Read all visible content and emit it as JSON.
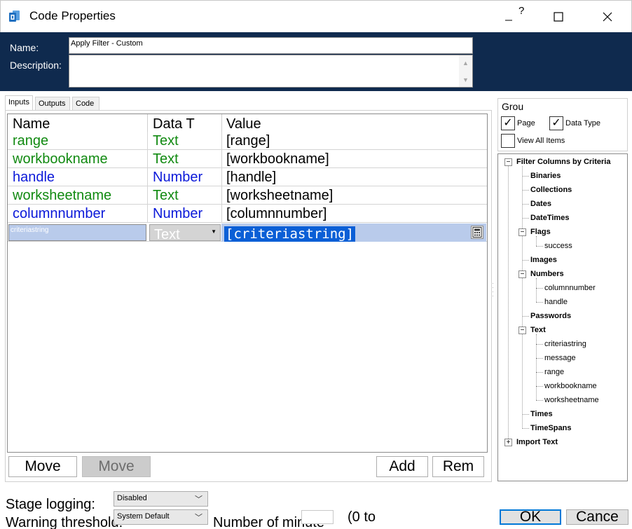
{
  "window": {
    "title": "Code Properties",
    "help": "?",
    "minimize": "—",
    "maximize": "☐",
    "close": "✕"
  },
  "header": {
    "name_label": "Name:",
    "description_label": "Description:",
    "name_value": "Apply Filter - Custom",
    "description_value": ""
  },
  "tabs": [
    {
      "label": "Inputs",
      "active": true
    },
    {
      "label": "Outputs",
      "active": false
    },
    {
      "label": "Code",
      "active": false
    }
  ],
  "grid": {
    "columns": [
      "Name",
      "Data T",
      "Value"
    ],
    "rows": [
      {
        "name": "range",
        "type": "Text",
        "value": "[range]",
        "color": "#118a11"
      },
      {
        "name": "workbookname",
        "type": "Text",
        "value": "[workbookname]",
        "color": "#118a11"
      },
      {
        "name": "handle",
        "type": "Number",
        "value": "[handle]",
        "color": "#0b19d9"
      },
      {
        "name": "worksheetname",
        "type": "Text",
        "value": "[worksheetname]",
        "color": "#118a11"
      },
      {
        "name": "columnnumber",
        "type": "Number",
        "value": "[columnnumber]",
        "color": "#0b19d9"
      }
    ],
    "edit_row": {
      "name": "criteriastring",
      "type": "Text",
      "value": "[criteriastring]"
    }
  },
  "buttons": {
    "move_up": "Move",
    "move_down": "Move",
    "add": "Add",
    "remove": "Rem",
    "ok": "OK",
    "cancel": "Cance"
  },
  "group": {
    "title": "Grou",
    "page_label": "Page",
    "page_checked": true,
    "datatype_label": "Data Type",
    "datatype_checked": true,
    "view_all_label": "View All Items",
    "view_all_checked": false
  },
  "tree": {
    "root": "Filter Columns by Criteria",
    "binaries": "Binaries",
    "collections": "Collections",
    "dates": "Dates",
    "datetimes": "DateTimes",
    "flags": "Flags",
    "flags_success": "success",
    "images": "Images",
    "numbers": "Numbers",
    "num_columnnumber": "columnnumber",
    "num_handle": "handle",
    "passwords": "Passwords",
    "text": "Text",
    "txt_criteriastring": "criteriastring",
    "txt_message": "message",
    "txt_range": "range",
    "txt_workbookname": "workbookname",
    "txt_worksheetname": "worksheetname",
    "times": "Times",
    "timespans": "TimeSpans",
    "import_text": "Import Text"
  },
  "bottom": {
    "stage_logging_label": "Stage logging:",
    "stage_logging_value": "Disabled",
    "warning_label": "Warning threshold:",
    "warning_value": "System Default",
    "minutes_label": "Number of minute",
    "range_hint": "(0 to"
  },
  "colors": {
    "header_bg": "#0f2a4e",
    "text_green": "#118a11",
    "number_blue": "#0b19d9",
    "selection": "#0b5fd6"
  }
}
